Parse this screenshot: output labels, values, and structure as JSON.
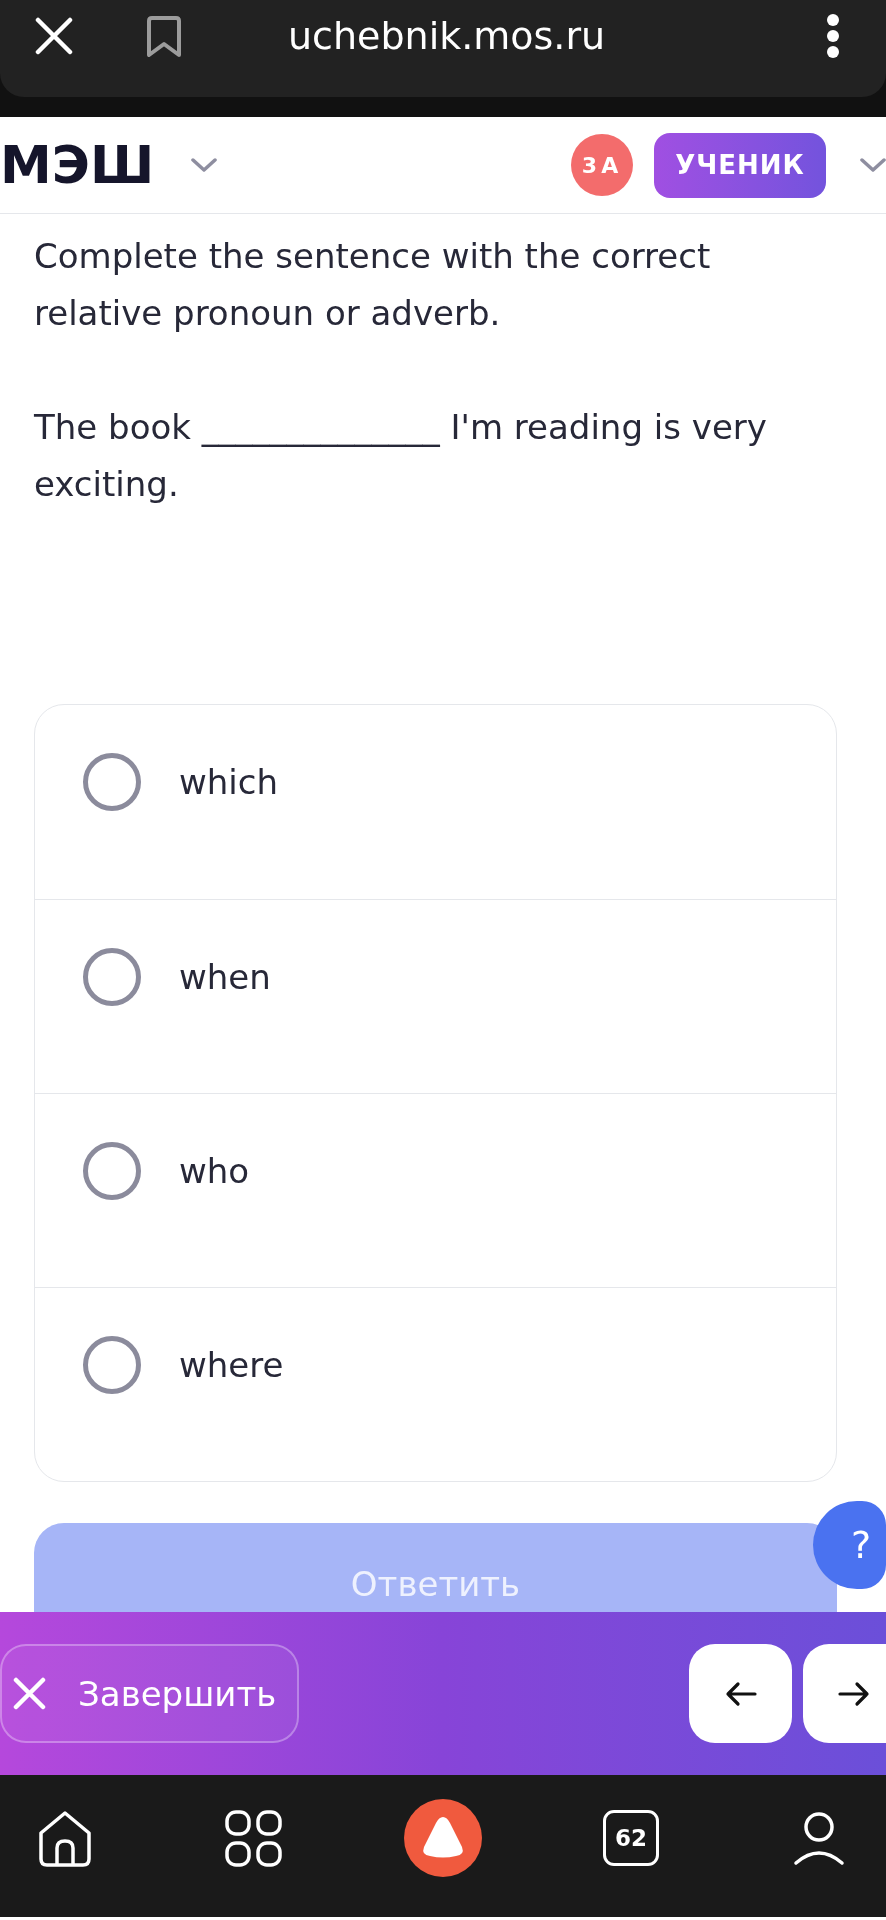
{
  "browser_bar": {
    "url": "uchebnik.mos.ru"
  },
  "header": {
    "logo": "МЭШ",
    "class_badge": "3А",
    "role_button": "УЧЕНИК"
  },
  "question": {
    "instruction": "Complete the sentence with the correct relative pronoun or adverb.",
    "sentence": "The book ______________ I'm reading is very exciting."
  },
  "options": [
    {
      "label": "which",
      "selected": false
    },
    {
      "label": "when",
      "selected": false
    },
    {
      "label": "who",
      "selected": false
    },
    {
      "label": "where",
      "selected": false
    }
  ],
  "answer_button": {
    "label": "Ответить",
    "disabled": true
  },
  "help_button": {
    "label": "?"
  },
  "bottom_bar": {
    "finish_button": "Завершить"
  },
  "nav_bar": {
    "tab_count": "62"
  }
}
